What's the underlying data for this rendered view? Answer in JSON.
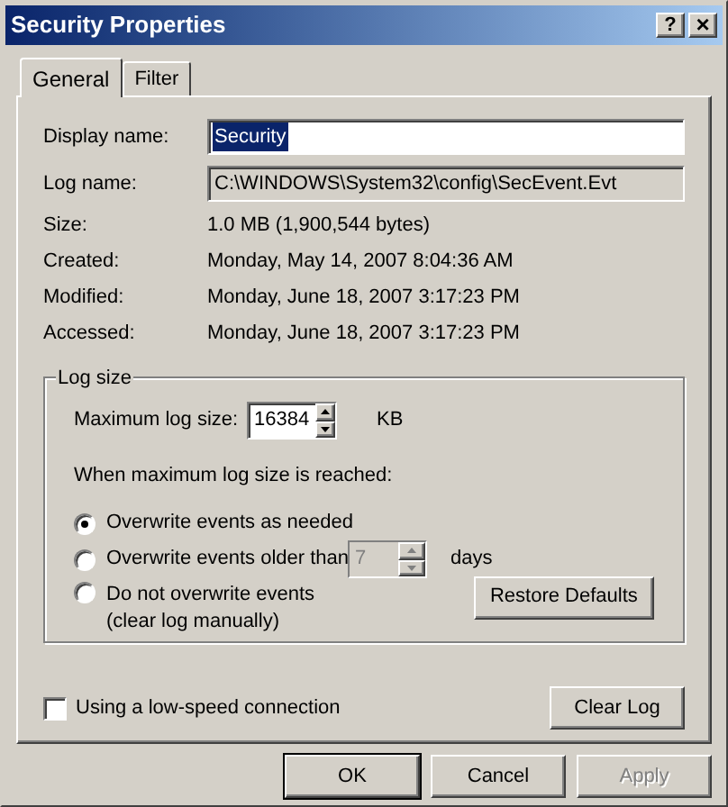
{
  "window": {
    "title": "Security Properties",
    "help_button": "?",
    "close_button": "×"
  },
  "tabs": [
    {
      "label": "General",
      "selected": true
    },
    {
      "label": "Filter",
      "selected": false
    }
  ],
  "display_name": {
    "label": "Display name:",
    "value": "Security",
    "selected": true
  },
  "log_name": {
    "label": "Log name:",
    "value": "C:\\WINDOWS\\System32\\config\\SecEvent.Evt",
    "disabled": true
  },
  "info": [
    {
      "label": "Size:",
      "value": "1.0 MB (1,900,544 bytes)"
    },
    {
      "label": "Created:",
      "value": "Monday, May 14, 2007 8:04:36 AM"
    },
    {
      "label": "Modified:",
      "value": "Monday, June 18, 2007 3:17:23 PM"
    },
    {
      "label": "Accessed:",
      "value": "Monday, June 18, 2007 3:17:23 PM"
    }
  ],
  "log_size": {
    "title": "Log size",
    "max_size": {
      "label": "Maximum log size:",
      "value": "16384",
      "unit": "KB"
    },
    "when_label": "When maximum log size is reached:",
    "options": [
      {
        "kind": "plain",
        "label": "Overwrite events as needed",
        "selected": true
      },
      {
        "kind": "days",
        "label": "Overwrite events older than",
        "value": "7",
        "unit": "days",
        "disabled": true,
        "selected": false
      },
      {
        "kind": "note",
        "label": "Do not overwrite events",
        "note": "(clear log manually)",
        "selected": false
      }
    ],
    "restore_button": "Restore Defaults"
  },
  "low_speed": {
    "label": "Using a low-speed connection",
    "checked": false
  },
  "clear_log_button": "Clear Log",
  "buttons": [
    {
      "label": "OK",
      "default": true,
      "disabled": false
    },
    {
      "label": "Cancel",
      "default": false,
      "disabled": false
    },
    {
      "label": "Apply",
      "default": false,
      "disabled": true
    }
  ]
}
